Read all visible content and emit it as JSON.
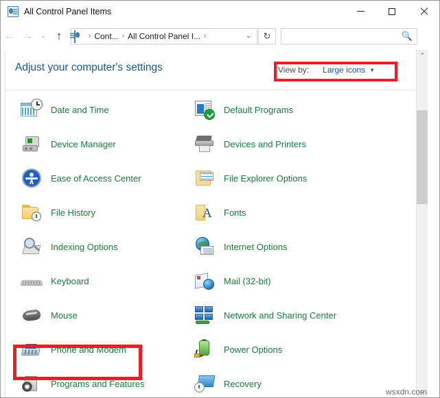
{
  "window": {
    "title": "All Control Panel Items",
    "icon": "control-panel-icon",
    "minimize_label": "—",
    "maximize_label": "□",
    "close_label": "✕"
  },
  "addressbar": {
    "back_label": "←",
    "forward_label": "→",
    "recent_label": "⌄",
    "up_label": "↑",
    "breadcrumb": {
      "icon": "control-panel-icon",
      "items": [
        "Cont...",
        "All Control Panel I..."
      ],
      "separator": "›",
      "dropdown_caret": "⌄"
    },
    "refresh_label": "↻",
    "search": {
      "value": "",
      "placeholder": "",
      "icon": "search-icon"
    }
  },
  "main": {
    "heading": "Adjust your computer's settings",
    "view_by": {
      "label": "View by:",
      "value": "Large icons",
      "caret": "▼",
      "highlighted": true
    },
    "highlight_color": "#ee1c25",
    "item_text_color": "#1a7a3c",
    "heading_color": "#14569e",
    "items_left": [
      {
        "label": "Date and Time",
        "icon": "date-and-time-icon"
      },
      {
        "label": "Device Manager",
        "icon": "device-manager-icon"
      },
      {
        "label": "Ease of Access Center",
        "icon": "ease-of-access-icon"
      },
      {
        "label": "File History",
        "icon": "file-history-icon"
      },
      {
        "label": "Indexing Options",
        "icon": "indexing-options-icon"
      },
      {
        "label": "Keyboard",
        "icon": "keyboard-icon"
      },
      {
        "label": "Mouse",
        "icon": "mouse-icon",
        "highlighted": true
      },
      {
        "label": "Phone and Modem",
        "icon": "phone-and-modem-icon"
      },
      {
        "label": "Programs and Features",
        "icon": "programs-and-features-icon"
      }
    ],
    "items_right": [
      {
        "label": "Default Programs",
        "icon": "default-programs-icon"
      },
      {
        "label": "Devices and Printers",
        "icon": "devices-and-printers-icon"
      },
      {
        "label": "File Explorer Options",
        "icon": "file-explorer-options-icon"
      },
      {
        "label": "Fonts",
        "icon": "fonts-icon"
      },
      {
        "label": "Internet Options",
        "icon": "internet-options-icon"
      },
      {
        "label": "Mail (32-bit)",
        "icon": "mail-icon"
      },
      {
        "label": "Network and Sharing Center",
        "icon": "network-and-sharing-icon"
      },
      {
        "label": "Power Options",
        "icon": "power-options-icon"
      },
      {
        "label": "Recovery",
        "icon": "recovery-icon"
      }
    ]
  },
  "scrollbar": {
    "up_arrow": "⌃",
    "down_arrow": "⌄"
  },
  "watermark": "wsxdn.com"
}
